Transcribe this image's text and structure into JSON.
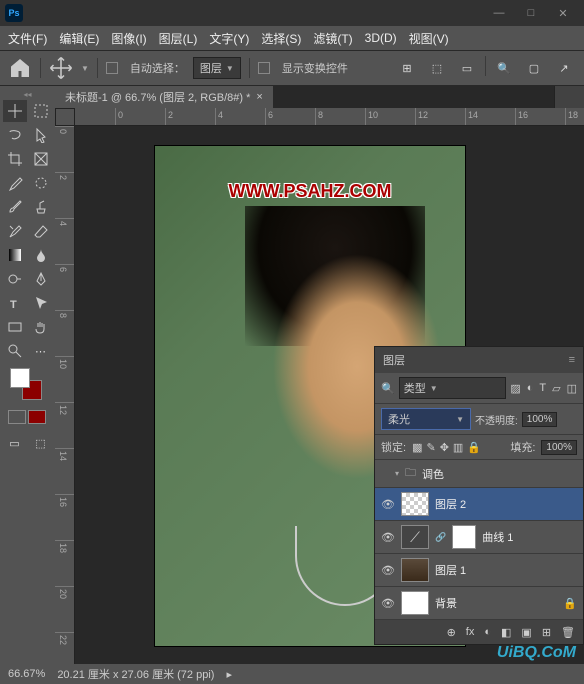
{
  "title_bar": {
    "ps": "Ps"
  },
  "win": {
    "min": "—",
    "max": "□",
    "close": "✕"
  },
  "menu": [
    "文件(F)",
    "编辑(E)",
    "图像(I)",
    "图层(L)",
    "文字(Y)",
    "选择(S)",
    "滤镜(T)",
    "3D(D)",
    "视图(V)"
  ],
  "options": {
    "auto_select_label": "自动选择：",
    "layer_dropdown": "图层",
    "show_transform": "显示变换控件"
  },
  "doc_tab": {
    "title": "未标题-1 @ 66.7% (图层 2, RGB/8#) *",
    "close": "×"
  },
  "ruler_h": [
    0,
    2,
    4,
    6,
    8,
    10,
    12,
    14,
    16,
    18
  ],
  "ruler_v": [
    0,
    2,
    4,
    6,
    8,
    10,
    12,
    14,
    16,
    18,
    20,
    22
  ],
  "watermark_top": "WWW.PSAHZ.COM",
  "watermark_br": "UiBQ.CoM",
  "layers_panel": {
    "title": "图层",
    "type_label": "类型",
    "blend_mode": "柔光",
    "opacity_label": "不透明度:",
    "opacity_value": "100%",
    "lock_label": "锁定:",
    "fill_label": "填充:",
    "fill_value": "100%",
    "group_label": "调色",
    "layers": [
      {
        "name": "图层 2",
        "thumb": "checker",
        "selected": true
      },
      {
        "name": "曲线 1",
        "thumb": "adj",
        "mask": true
      },
      {
        "name": "图层 1",
        "thumb": "face"
      },
      {
        "name": "背景",
        "thumb": "white",
        "locked": true
      }
    ],
    "footer_icons": [
      "⊕",
      "fx",
      "◐",
      "◧",
      "▣",
      "⊞",
      "🗑"
    ]
  },
  "status": {
    "zoom": "66.67%",
    "doc_info": "20.21 厘米 x 27.06 厘米 (72 ppi)"
  },
  "colors": {
    "fg": "#ffffff",
    "bg": "#8b0000"
  }
}
